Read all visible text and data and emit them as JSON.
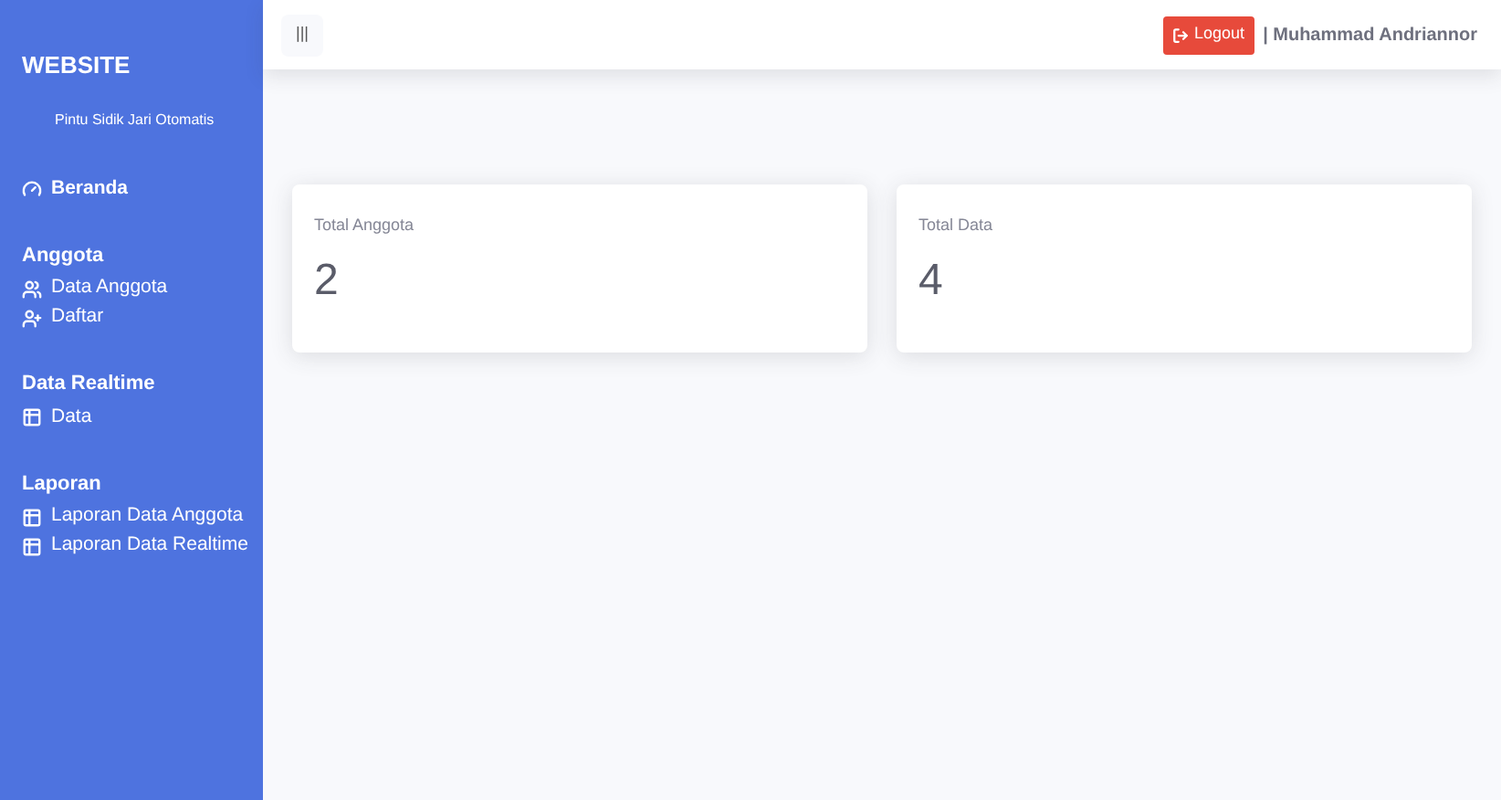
{
  "sidebar": {
    "brand": "WEBSITE",
    "subtitle": "Pintu Sidik Jari Otomatis",
    "items": [
      {
        "kind": "dashboard",
        "label": "Beranda"
      },
      {
        "kind": "heading",
        "label": "Anggota"
      },
      {
        "kind": "members",
        "label": "Data Anggota"
      },
      {
        "kind": "register",
        "label": "Daftar"
      },
      {
        "kind": "heading",
        "label": "Data Realtime"
      },
      {
        "kind": "table",
        "label": "Data"
      },
      {
        "kind": "heading",
        "label": "Laporan"
      },
      {
        "kind": "table",
        "label": "Laporan Data Anggota"
      },
      {
        "kind": "table",
        "label": "Laporan Data Realtime"
      }
    ]
  },
  "topbar": {
    "toggle": "|||",
    "logout": "Logout",
    "user": "| Muhammad Andriannor"
  },
  "cards": [
    {
      "title": "Total Anggota",
      "value": "2"
    },
    {
      "title": "Total Data",
      "value": "4"
    }
  ]
}
